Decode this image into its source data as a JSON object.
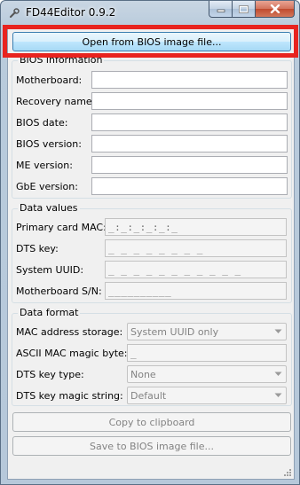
{
  "window": {
    "title": "FD44Editor 0.9.2",
    "icons": {
      "app": "wrench-icon",
      "minimize": "minimize-icon",
      "maximize": "maximize-icon",
      "close": "close-icon"
    }
  },
  "open_button": {
    "label": "Open from BIOS image file..."
  },
  "bios_info": {
    "title": "BIOS information",
    "fields": [
      {
        "label": "Motherboard:",
        "value": ""
      },
      {
        "label": "Recovery name:",
        "value": ""
      },
      {
        "label": "BIOS date:",
        "value": ""
      },
      {
        "label": "BIOS version:",
        "value": ""
      },
      {
        "label": "ME version:",
        "value": ""
      },
      {
        "label": "GbE version:",
        "value": ""
      }
    ]
  },
  "data_values": {
    "title": "Data values",
    "fields": [
      {
        "label": "Primary card MAC:",
        "value": "_:_:_:_:_:_"
      },
      {
        "label": "DTS key:",
        "value": "_ _ _ _ _ _ _ _"
      },
      {
        "label": "System UUID:",
        "value": "_ _ _ _ _ _ _ _ _ _ _"
      },
      {
        "label": "Motherboard S/N:",
        "value": "__________"
      }
    ]
  },
  "data_format": {
    "title": "Data format",
    "mac_storage": {
      "label": "MAC address storage:",
      "value": "System UUID only"
    },
    "ascii_magic": {
      "label": "ASCII MAC magic byte:",
      "value": "_"
    },
    "dts_type": {
      "label": "DTS key type:",
      "value": "None"
    },
    "dts_magic": {
      "label": "DTS key magic string:",
      "value": "Default"
    }
  },
  "copy_button": {
    "label": "Copy to clipboard"
  },
  "save_button": {
    "label": "Save to BIOS image file..."
  },
  "colors": {
    "highlight": "#e8231f",
    "primary_button": "#bee6fd"
  }
}
